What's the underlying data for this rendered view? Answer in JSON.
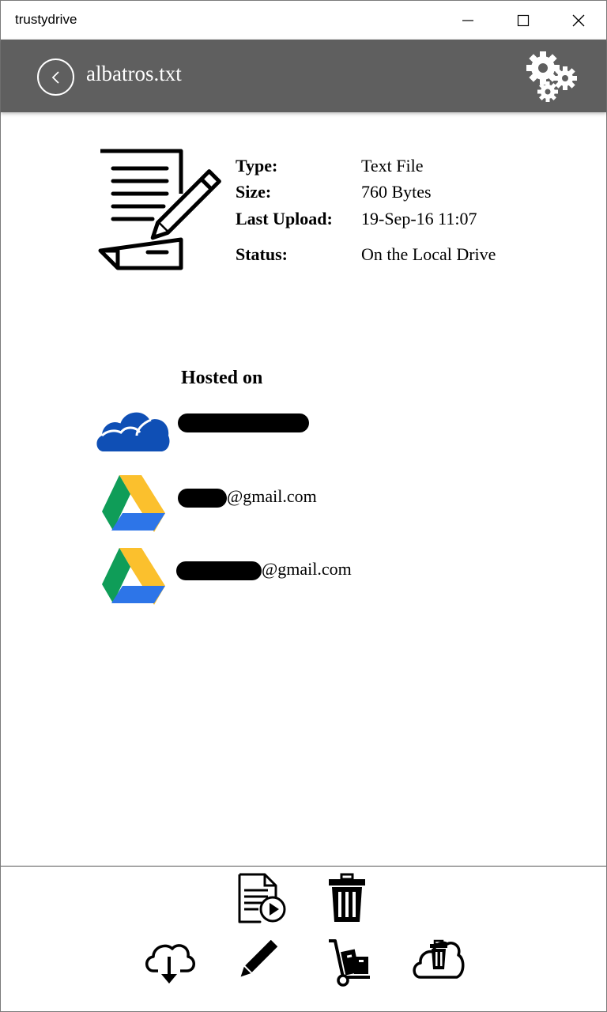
{
  "window": {
    "app_title": "trustydrive",
    "controls": [
      "minimize",
      "maximize",
      "close"
    ]
  },
  "header": {
    "title": "albatros.txt",
    "back_icon": "back-arrow-icon",
    "settings_icon": "gears-icon",
    "background": "#5f5f5f"
  },
  "file_info": {
    "icon": "document-edit-icon",
    "type_label": "Type:",
    "type_value": "Text File",
    "size_label": "Size:",
    "size_value": "760 Bytes",
    "upload_label": "Last Upload:",
    "upload_value": "19-Sep-16 11:07",
    "status_label": "Status:",
    "status_value": "On the Local Drive"
  },
  "hosted": {
    "title": "Hosted on",
    "providers": [
      {
        "service": "onedrive",
        "icon": "onedrive-icon",
        "account": "",
        "redacted": true
      },
      {
        "service": "google-drive",
        "icon": "google-drive-icon",
        "account": "@gmail.com",
        "redacted": true
      },
      {
        "service": "google-drive",
        "icon": "google-drive-icon",
        "account": "@gmail.com",
        "redacted": true
      }
    ]
  },
  "actions": [
    {
      "name": "open-file",
      "icon": "file-open-icon"
    },
    {
      "name": "delete",
      "icon": "trash-icon"
    },
    {
      "name": "download",
      "icon": "cloud-download-icon"
    },
    {
      "name": "rename",
      "icon": "pencil-icon"
    },
    {
      "name": "move",
      "icon": "hand-truck-icon"
    },
    {
      "name": "delete-from-cloud",
      "icon": "cloud-trash-icon"
    }
  ],
  "colors": {
    "onedrive": "#0f4fb5",
    "drive_green": "#0f9d58",
    "drive_yellow": "#fbc02d",
    "drive_blue": "#2d75e8"
  }
}
